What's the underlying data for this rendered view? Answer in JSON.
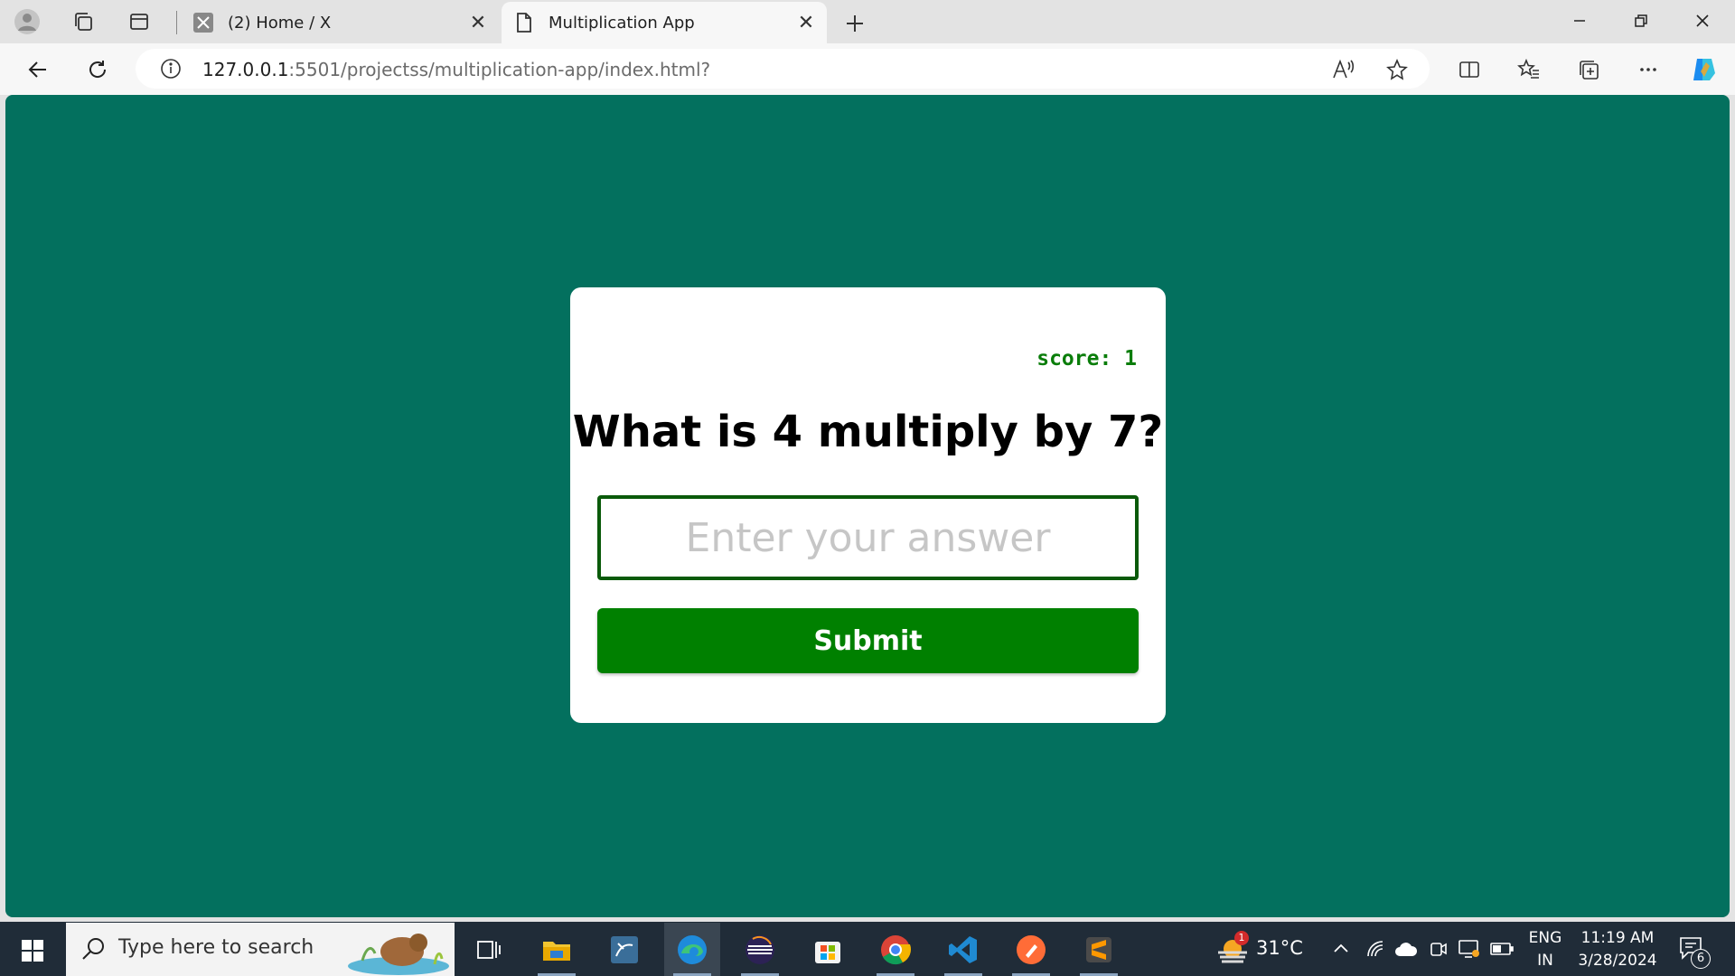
{
  "browser": {
    "tabs": [
      {
        "label": "(2) Home / X",
        "icon": "x-logo-icon",
        "active": false
      },
      {
        "label": "Multiplication App",
        "icon": "page-icon",
        "active": true
      }
    ],
    "address": {
      "host": "127.0.0.1",
      "path": ":5501/projectss/multiplication-app/index.html?"
    }
  },
  "app": {
    "score_label": "score: 1",
    "question": "What is 4 multiply by 7?",
    "answer_placeholder": "Enter your answer",
    "answer_value": "",
    "submit_label": "Submit",
    "colors": {
      "background": "#03705e",
      "card": "#ffffff",
      "submit": "#008000",
      "score": "#0a7d0a"
    }
  },
  "taskbar": {
    "search_placeholder": "Type here to search",
    "pinned_apps": [
      "task-view",
      "file-explorer",
      "mysql-workbench",
      "edge",
      "eclipse",
      "microsoft-store",
      "chrome",
      "vs-code",
      "postman",
      "sublime-text"
    ],
    "weather": {
      "temperature": "31°C",
      "badge": "1"
    },
    "language": [
      "ENG",
      "IN"
    ],
    "time": "11:19 AM",
    "date": "3/28/2024",
    "notifications": "6"
  }
}
